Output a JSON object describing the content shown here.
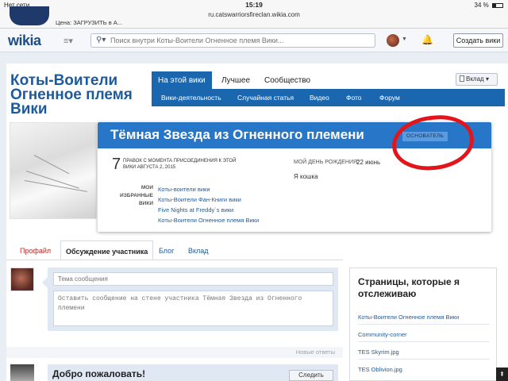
{
  "status_bar": {
    "carrier": "Нет сети",
    "time": "15:19",
    "battery": "34 %"
  },
  "browser": {
    "url": "ru.catswarriorsfireclan.wikia.com",
    "ad_text": "Цена: ЗАГРУЗИТЬ в А..."
  },
  "global_nav": {
    "logo": "wikia",
    "search_placeholder": "Поиск внутри Коты-Воители Огненное племя Вики...",
    "create_wiki": "Создать вики"
  },
  "wiki": {
    "name": "Коты-Воители Огненное племя Вики",
    "tabs": [
      "На этой вики",
      "Лучшее",
      "Сообщество"
    ],
    "subnav": [
      "Вики-деятельность",
      "Случайная статья",
      "Видео",
      "Фото",
      "Форум"
    ],
    "enter_button": "Вклад"
  },
  "masthead": {
    "user_name": "Тёмная Звезда из Огненного племени",
    "badge": "ОСНОВАТЕЛЬ",
    "edit_count": "7",
    "edit_label": "ПРАВОК С МОМЕНТА ПРИСОЕДИНЕНИЯ К ЭТОЙ ВИКИ АВГУСТА 2, 2015",
    "birthday_label": "МОЙ ДЕНЬ РОЖДЕНИЯ:",
    "birthday_value": "22 июнь",
    "about": "Я кошка",
    "wikis_label": "МОИ ИЗБРАННЫЕ ВИКИ",
    "wikis": [
      "Коты-воители вики",
      "Коты-Воители Фан-Книги вики",
      "Five Nights at Freddy`s вики",
      "Коты-Воители Огненное племя Вики"
    ]
  },
  "profile_tabs": [
    "Профайл",
    "Обсуждение участника",
    "Блог",
    "Вклад"
  ],
  "message_wall": {
    "subject_placeholder": "Тема сообщения",
    "body_placeholder": "Оставить сообщение на стене участника Тёмная Звезда из Огненного племени",
    "newer_replies": "Новые ответы",
    "thread_title": "Добро пожаловать!",
    "follow_button": "Следить"
  },
  "rail": {
    "title": "Страницы, которые я отслеживаю",
    "links": [
      "Коты-Воители Огненное племя Вики",
      "Community-corner",
      "TES Skyrim.jpg",
      "TES Oblivion.jpg"
    ]
  },
  "icons": {
    "search": "search-icon",
    "notifications": "bell-icon",
    "hub_menu": "hamburger-icon",
    "scroll_top": "chevron-up-icon"
  },
  "colors": {
    "brand_blue": "#1a67b0",
    "name_bar": "#2876c7",
    "highlight_red": "#e3151a"
  }
}
